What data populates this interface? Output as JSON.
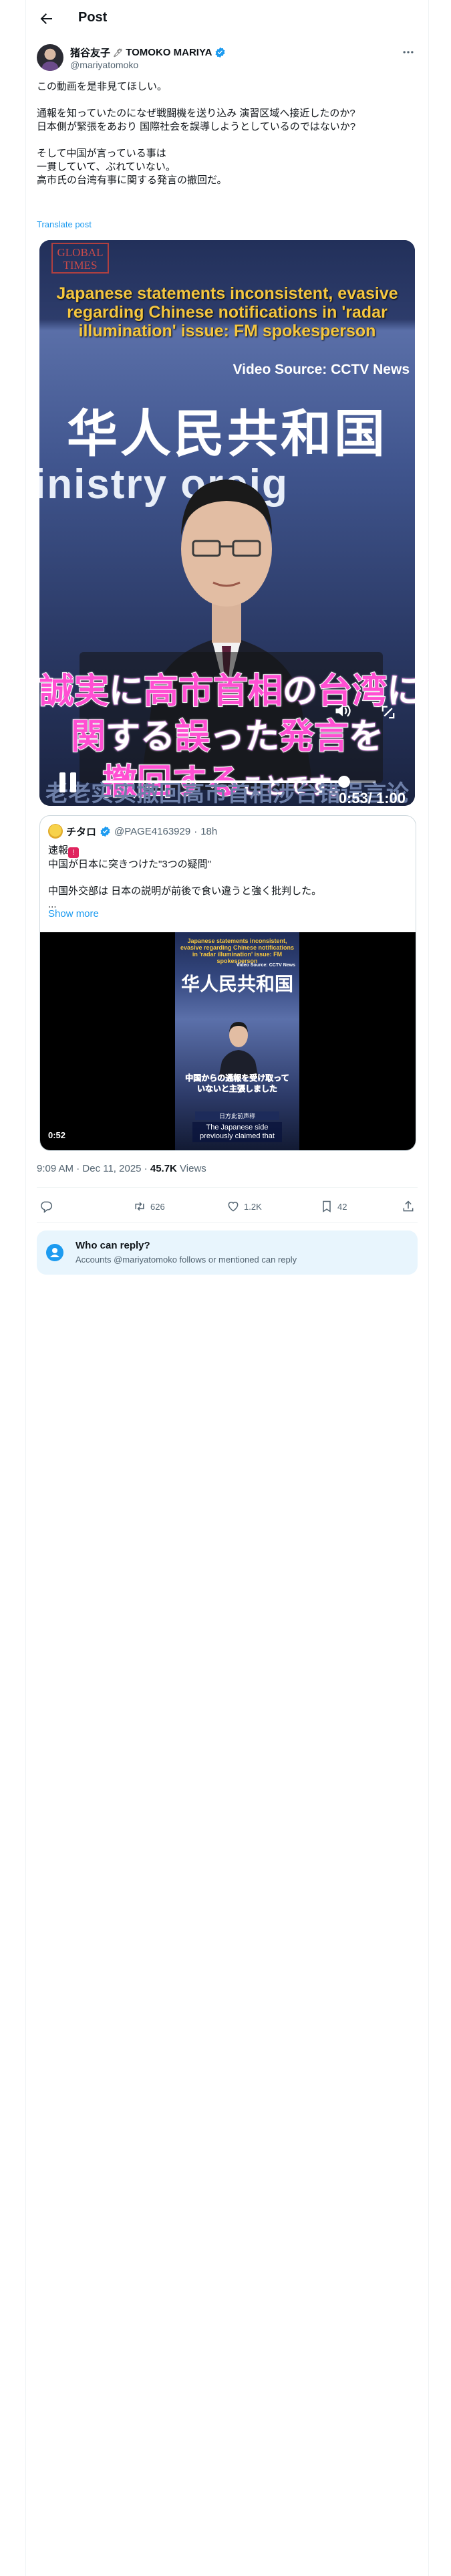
{
  "header": {
    "title": "Post"
  },
  "post": {
    "author_name": "猪谷友子",
    "author_name_suffix": "TOMOKO MARIYA",
    "handle": "@mariyatomoko",
    "text": "この動画を是非見てほしい。\n\n通報を知っていたのになぜ戦闘機を送り込み 演習区域へ接近したのか?\n日本側が緊張をあおり 国際社会を誤導しようとしているのではないか?\n\nそして中国が言っている事は\n一貫していて、ぶれていない。\n高市氏の台湾有事に関する発言の撤回だ。",
    "translate_label": "Translate post",
    "video": {
      "logo": "GLOBAL\nTIMES",
      "headline": "Japanese statements inconsistent, evasive regarding Chinese notifications in 'radar illumination' issue: FM spokesperson",
      "source": "Video Source: CCTV News",
      "bg_chars": "华人民共和国",
      "bg_ministry": "inistry  oreig",
      "caption_line1": [
        "誠実",
        "に",
        "高市首相",
        "の",
        "台湾",
        "に"
      ],
      "caption_line2": [
        "関",
        "する",
        "誤",
        "った",
        "発言",
        "を"
      ],
      "caption_line3": [
        "撤回する",
        "ことです。"
      ],
      "bottom_text": "老老实实撤回高市首相涉台错误言论",
      "time": "0:53/ 1:00",
      "progress": 0.883
    }
  },
  "quote": {
    "name": "チタロ",
    "handle": "@PAGE4163929",
    "age": "18h",
    "line1": "速報",
    "line2": "中国が日本に突きつけた\"3つの疑問\"",
    "line3": "中国外交部は 日本の説明が前後で食い違うと強く批判した。",
    "ellipsis": "...",
    "show_more": "Show more",
    "video": {
      "headline": "Japanese statements inconsistent, evasive regarding Chinese notifications in 'radar illumination' issue: FM spokesperson",
      "source": "Video Source: CCTV News",
      "bg_chars": "华人民共和国",
      "caption": "中国からの通報を受け取っていないと主張しました",
      "label": "日方此前声称",
      "subtitle": "The Japanese side previously claimed that",
      "time": "0:52"
    }
  },
  "meta": {
    "time": "9:09 AM",
    "sep1": " · ",
    "date": "Dec 11, 2025",
    "sep2": " · ",
    "views_count": "45.7K",
    "views_label": " Views"
  },
  "actions": {
    "retweets": "626",
    "likes": "1.2K",
    "bookmarks": "42"
  },
  "reply_restriction": {
    "title": "Who can reply?",
    "subtitle": "Accounts @mariyatomoko follows or mentioned can reply"
  },
  "colors": {
    "accent": "#1d9bf0",
    "text": "#0f1419",
    "secondary": "#536471",
    "caption_pink": "#ff4fd2",
    "headline_gold": "#f4c640"
  }
}
